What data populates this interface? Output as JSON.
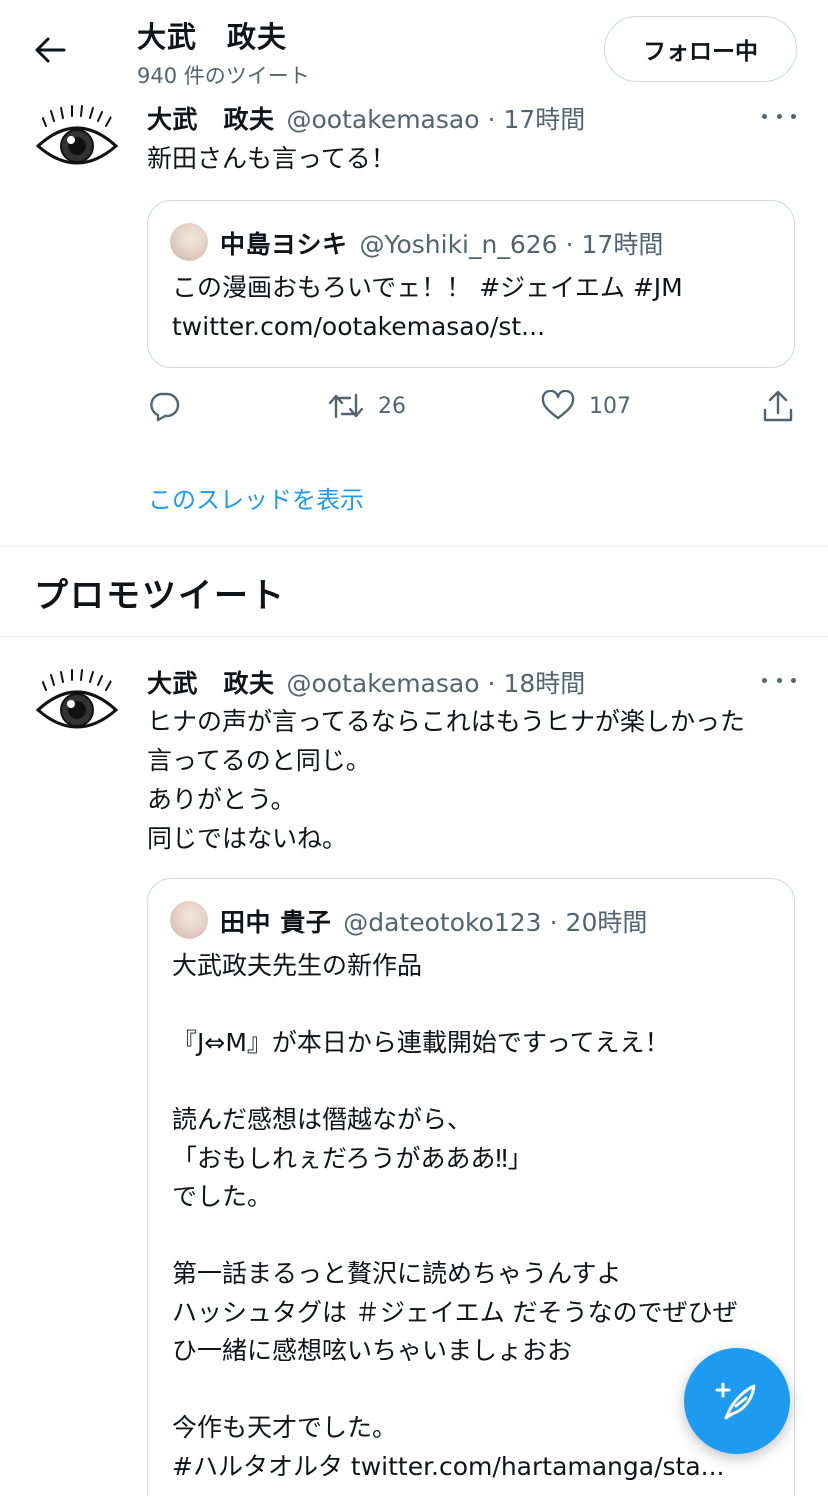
{
  "header": {
    "title": "大武　政夫",
    "subtitle": "940 件のツイート",
    "follow_label": "フォロー中"
  },
  "tweets": [
    {
      "name": "大武　政夫",
      "handle": "@ootakemasao",
      "dot": "·",
      "time": "17時間",
      "text": "新田さんも言ってる！",
      "quote": {
        "name": "中島ヨシキ",
        "handle": "@Yoshiki_n_626",
        "dot": "·",
        "time": "17時間",
        "text": "この漫画おもろいでェ！！ #ジェイエム #JM\ntwitter.com/ootakemasao/st..."
      },
      "retweets": "26",
      "likes": "107",
      "show_thread": "このスレッドを表示"
    },
    {
      "name": "大武　政夫",
      "handle": "@ootakemasao",
      "dot": "·",
      "time": "18時間",
      "text": "ヒナの声が言ってるならこれはもうヒナが楽しかった\n言ってるのと同じ。\nありがとう。\n同じではないね。",
      "quote": {
        "name": "田中 貴子",
        "handle": "@dateotoko123",
        "dot": "·",
        "time": "20時間",
        "text": "大武政夫先生の新作品\n\n『J⇔M』が本日から連載開始ですってええ！\n\n読んだ感想は僭越ながら、\n「おもしれぇだろうがあああ‼」\nでした。\n\n第一話まるっと贅沢に読めちゃうんすよ\nハッシュタグは ＃ジェイエム だそうなのでぜひぜ\nひ一緒に感想呟いちゃいましょおお\n\n今作も天才でした。\n#ハルタオルタ twitter.com/hartamanga/sta..."
      }
    }
  ],
  "section": {
    "promo_title": "プロモツイート"
  },
  "colors": {
    "accent": "#1d9bf0",
    "text": "#0f1419",
    "secondary": "#536471",
    "border": "#cfd9de"
  }
}
